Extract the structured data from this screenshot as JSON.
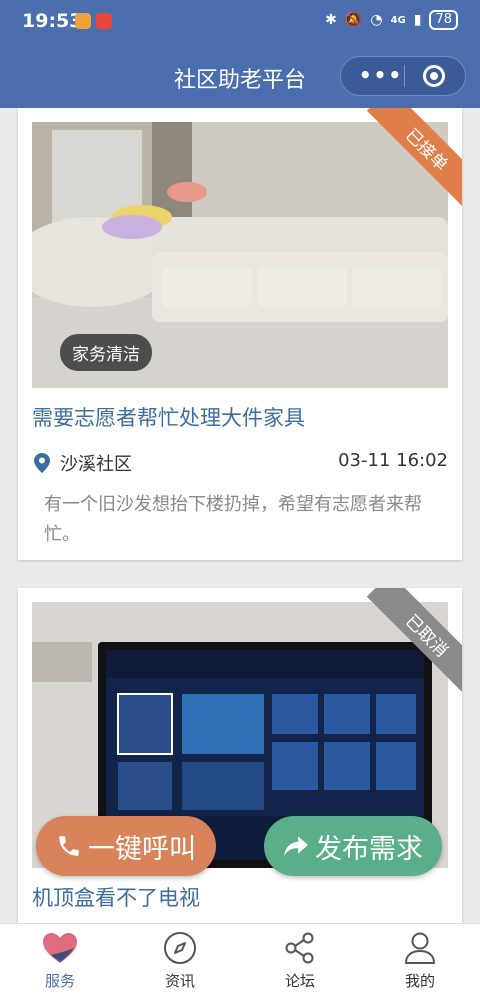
{
  "status_bar": {
    "time": "19:53",
    "network": "4G",
    "battery": "78"
  },
  "header": {
    "title": "社区助老平台",
    "more_icon": "more-dots-icon",
    "close_icon": "target-close-icon",
    "color": "#4b6eae"
  },
  "cards": [
    {
      "status": "已接单",
      "status_color": "#e07f4a",
      "category": "家务清洁",
      "title": "需要志愿者帮忙处理大件家具",
      "community": "沙溪社区",
      "time": "03-11 16:02",
      "description": "有一个旧沙发想抬下楼扔掉，希望有志愿者来帮忙。"
    },
    {
      "status": "已取消",
      "status_color": "#8a8a8a",
      "title": "机顶盒看不了电视"
    }
  ],
  "fab": {
    "call": "一键呼叫",
    "publish": "发布需求",
    "call_color": "#d8835a",
    "publish_color": "#5aae8a"
  },
  "tabs": [
    {
      "label": "服务",
      "icon": "heart-icon",
      "active": true
    },
    {
      "label": "资讯",
      "icon": "compass-icon",
      "active": false
    },
    {
      "label": "论坛",
      "icon": "share-icon",
      "active": false
    },
    {
      "label": "我的",
      "icon": "user-icon",
      "active": false
    }
  ]
}
